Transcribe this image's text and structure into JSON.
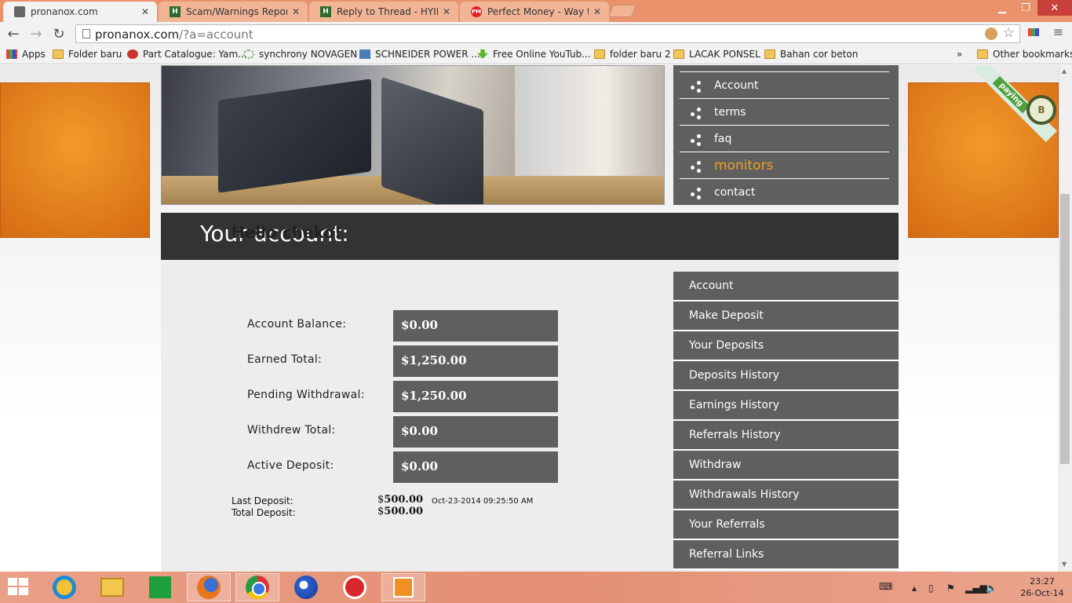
{
  "browser": {
    "tabs": [
      {
        "title": "pronanox.com",
        "active": true,
        "favicon": "page-icon"
      },
      {
        "title": "Scam/Warnings Reports (I",
        "active": false,
        "favicon": "H"
      },
      {
        "title": "Reply to Thread - HYIP - N",
        "active": false,
        "favicon": "H"
      },
      {
        "title": "Perfect Money - Way to d",
        "active": false,
        "favicon": "PM"
      }
    ],
    "url_host": "pronanox.com",
    "url_path": "/?a=account",
    "bookmarks": [
      {
        "label": "Apps",
        "icon": "apps-icon"
      },
      {
        "label": "Folder baru",
        "icon": "folder-icon"
      },
      {
        "label": "Part Catalogue: Yam...",
        "icon": "site-icon"
      },
      {
        "label": "synchrony NOVAGEN",
        "icon": "site-icon"
      },
      {
        "label": "SCHNEIDER POWER ...",
        "icon": "site-icon"
      },
      {
        "label": "Free Online YouTub...",
        "icon": "download-icon"
      },
      {
        "label": "folder baru 2",
        "icon": "folder-icon"
      },
      {
        "label": "LACAK PONSEL",
        "icon": "folder-icon"
      },
      {
        "label": "Bahan cor beton",
        "icon": "folder-icon"
      }
    ],
    "overflow": "»",
    "other_bookmarks": "Other bookmarks"
  },
  "site": {
    "badge_text": "paying",
    "badge_letter": "B",
    "top_nav": [
      {
        "label": "Account",
        "active": false
      },
      {
        "label": "terms",
        "active": false
      },
      {
        "label": "faq",
        "active": false
      },
      {
        "label": "monitors",
        "active": true
      },
      {
        "label": "contact",
        "active": false
      }
    ],
    "section_title": "Your account:",
    "greeting": "Hello cheko!",
    "stats": [
      {
        "label": "Account Balance:",
        "value": "$0.00"
      },
      {
        "label": "Earned Total:",
        "value": "$1,250.00"
      },
      {
        "label": "Pending Withdrawal:",
        "value": "$1,250.00"
      },
      {
        "label": "Withdrew Total:",
        "value": "$0.00"
      },
      {
        "label": "Active Deposit:",
        "value": "$0.00"
      }
    ],
    "last_deposit": {
      "label": "Last Deposit:",
      "currency": "$",
      "amount": "500.00",
      "date": "Oct-23-2014 09:25:50 AM"
    },
    "total_deposit": {
      "label": "Total Deposit:",
      "currency": "$",
      "amount": "500.00"
    },
    "side_menu": [
      "Account",
      "Make Deposit",
      "Your Deposits",
      "Deposits History",
      "Earnings History",
      "Referrals History",
      "Withdraw",
      "Withdrawals History",
      "Your Referrals",
      "Referral Links"
    ]
  },
  "taskbar": {
    "time": "23:27",
    "date": "26-Oct-14"
  },
  "colors": {
    "accent_orange": "#f0a020",
    "panel_gray": "#5f5f5f",
    "header_dark": "#333333"
  }
}
